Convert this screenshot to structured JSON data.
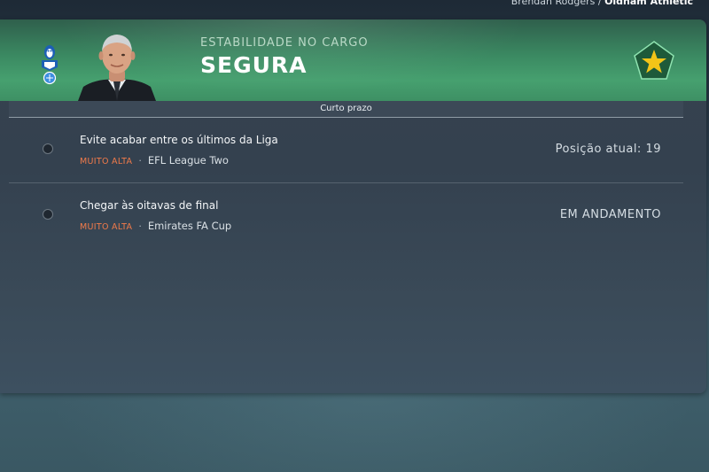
{
  "breadcrumb": {
    "manager": "Brendan Rodgers",
    "separator": " / ",
    "club": "Oldham Athletic"
  },
  "header": {
    "label": "ESTABILIDADE NO CARGO",
    "status": "SEGURA",
    "accent_color": "#46a06f"
  },
  "section": {
    "title": "Curto prazo"
  },
  "objectives": [
    {
      "title": "Evite acabar entre os últimos da Liga",
      "priority": "MUITO ALTA",
      "competition": "EFL League Two",
      "status": "Posição atual: 19"
    },
    {
      "title": "Chegar às oitavas de final",
      "priority": "MUITO ALTA",
      "competition": "Emirates FA Cup",
      "status": "EM ANDAMENTO"
    }
  ],
  "colors": {
    "priority": "#f07a4a",
    "star_badge": "#1e5a3a",
    "star": "#f2c418"
  }
}
